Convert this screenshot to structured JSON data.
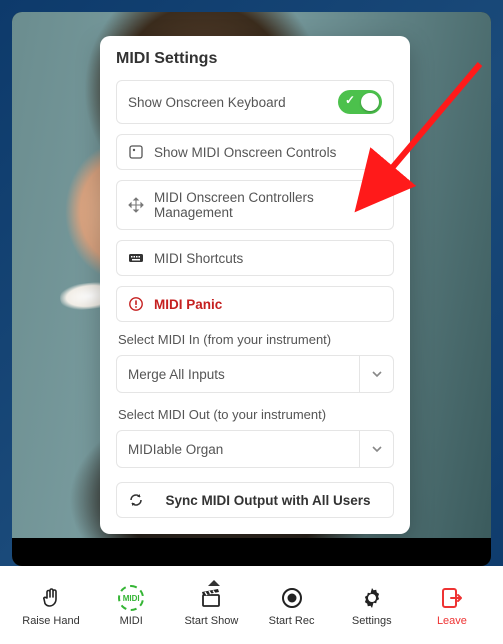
{
  "panel": {
    "title": "MIDI Settings",
    "items": {
      "show_keyboard": "Show Onscreen Keyboard",
      "show_controls": "Show MIDI Onscreen Controls",
      "controllers_mgmt": "MIDI Onscreen Controllers Management",
      "shortcuts": "MIDI Shortcuts",
      "panic": "MIDI Panic",
      "sync": "Sync MIDI Output with All Users"
    },
    "midi_in_label": "Select MIDI In (from your instrument)",
    "midi_in_value": "Merge All Inputs",
    "midi_out_label": "Select MIDI Out (to your instrument)",
    "midi_out_value": "MIDIable Organ"
  },
  "toolbar": {
    "raise_hand": "Raise Hand",
    "midi": "MIDI",
    "start_show": "Start Show",
    "start_rec": "Start Rec",
    "settings": "Settings",
    "leave": "Leave"
  }
}
